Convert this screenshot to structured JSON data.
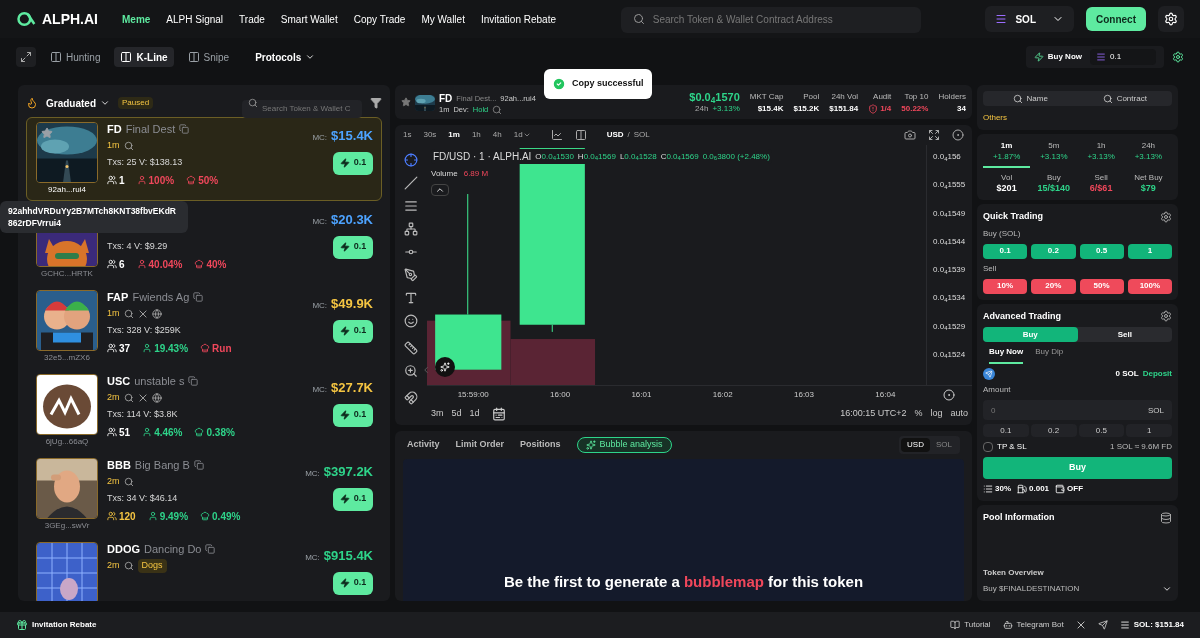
{
  "nav": {
    "logo": "ALPH.AI",
    "items": [
      {
        "label": "Meme",
        "selected": true
      },
      {
        "label": "ALPH Signal",
        "selected": false
      },
      {
        "label": "Trade",
        "selected": false
      },
      {
        "label": "Smart Wallet",
        "selected": false
      },
      {
        "label": "Copy Trade",
        "selected": false
      },
      {
        "label": "My Wallet",
        "selected": false
      },
      {
        "label": "Invitation Rebate",
        "selected": false
      }
    ],
    "search": {
      "placeholder": "Search Token & Wallet Contract Address"
    },
    "chain": "SOL",
    "connect": "Connect"
  },
  "toolbar": {
    "tabs": [
      {
        "label": "Hunting",
        "selected": false
      },
      {
        "label": "K-Line",
        "selected": true
      },
      {
        "label": "Snipe",
        "selected": false
      }
    ],
    "protocols": "Protocols",
    "buy_now": "Buy Now",
    "amount": "0.1"
  },
  "toast": "Copy successful",
  "list": {
    "filter": "Graduated",
    "status": "Paused",
    "search": {
      "placeholder": "Search Token & Wallet C"
    },
    "tooltip": "92ahhdVRDuYy2B7MTch8KNT38fbvEKdR862rDFVrrui4",
    "tokens": [
      {
        "symbol": "FD",
        "name": "Final Dest",
        "age": "1m",
        "socials": false,
        "stats_line": "Txs: 25 V: $138.13",
        "holders": {
          "value": "1",
          "color": "#ffffff"
        },
        "top10": {
          "value": "100%",
          "color": "#f0475b"
        },
        "dev": {
          "value": "50%",
          "color": "#f0475b"
        },
        "address": "92ah...rui4",
        "mc": {
          "label": "MC:",
          "value": "$15.4K",
          "color": "#4da3ff"
        },
        "buy": "0.1",
        "selected": true
      },
      {
        "stats_line": "Txs: 4 V: $9.29",
        "holders": {
          "value": "6",
          "color": "#ffffff"
        },
        "top10": {
          "value": "40.04%",
          "color": "#f0475b"
        },
        "dev": {
          "value": "40%",
          "color": "#f0475b"
        },
        "address": "GCHC...HRTK",
        "mc": {
          "label": "MC:",
          "value": "$20.3K",
          "color": "#4da3ff"
        },
        "buy": "0.1",
        "selected": false
      },
      {
        "symbol": "FAP",
        "name": "Fwiends Ag",
        "age": "1m",
        "socials": true,
        "stats_line": "Txs: 328 V: $259K",
        "holders": {
          "value": "37",
          "color": "#ffffff"
        },
        "top10": {
          "value": "19.43%",
          "color": "#2ed48a"
        },
        "dev": {
          "value": "Run",
          "color": "#f0475b"
        },
        "address": "32e5...mZX6",
        "mc": {
          "label": "MC:",
          "value": "$49.9K",
          "color": "#f5c542"
        },
        "buy": "0.1",
        "selected": false
      },
      {
        "symbol": "USC",
        "name": "unstable s",
        "age": "2m",
        "socials": true,
        "stats_line": "Txs: 114 V: $3.8K",
        "holders": {
          "value": "51",
          "color": "#ffffff"
        },
        "top10": {
          "value": "4.46%",
          "color": "#2ed48a"
        },
        "dev": {
          "value": "0.38%",
          "color": "#2ed48a"
        },
        "address": "6jUg...66aQ",
        "mc": {
          "label": "MC:",
          "value": "$27.7K",
          "color": "#f5c542"
        },
        "buy": "0.1",
        "selected": false
      },
      {
        "symbol": "BBB",
        "name": "Big Bang B",
        "age": "2m",
        "socials": false,
        "stats_line": "Txs: 34 V: $46.14",
        "holders": {
          "value": "120",
          "color": "#f5c542"
        },
        "top10": {
          "value": "9.49%",
          "color": "#2ed48a"
        },
        "dev": {
          "value": "0.49%",
          "color": "#2ed48a"
        },
        "address": "3GEg...swVr",
        "mc": {
          "label": "MC:",
          "value": "$397.2K",
          "color": "#2ed48a"
        },
        "buy": "0.1",
        "selected": false
      },
      {
        "symbol": "DDOG",
        "name": "Dancing Do",
        "age": "2m",
        "socials": false,
        "tag": "Dogs",
        "mc": {
          "label": "MC:",
          "value": "$915.4K",
          "color": "#2ed48a"
        },
        "buy": "0.1",
        "selected": false
      }
    ]
  },
  "token": {
    "symbol": "FD",
    "name": "Final Dest...",
    "address": "92ah...rui4",
    "age": "1m",
    "dev_label": "Dev:",
    "dev_status": "Hold",
    "price": "$0.0$_{4}$1570",
    "change_label": "24h",
    "change": "+3.13%",
    "metrics": [
      {
        "label": "MKT Cap",
        "value": "$15.4K",
        "color": "#ffffff"
      },
      {
        "label": "Pool",
        "value": "$15.2K",
        "color": "#ffffff"
      },
      {
        "label": "24h Vol",
        "value": "$151.84",
        "color": "#ffffff"
      },
      {
        "label": "Audit",
        "value": "1/4",
        "color": "#f0475b",
        "kind": "audit"
      },
      {
        "label": "Top 10",
        "value": "50.22%",
        "color": "#f0475b",
        "kind": "plain"
      },
      {
        "label": "Holders",
        "value": "34",
        "color": "#ffffff"
      }
    ]
  },
  "chart": {
    "timeframes": [
      {
        "label": "1s",
        "selected": false
      },
      {
        "label": "30s",
        "selected": false
      },
      {
        "label": "1m",
        "selected": true
      },
      {
        "label": "1h",
        "selected": false
      },
      {
        "label": "4h",
        "selected": false
      },
      {
        "label": "1d",
        "selected": false
      }
    ],
    "currencies": [
      {
        "label": "USD",
        "selected": true
      },
      {
        "label": "SOL",
        "selected": false
      }
    ],
    "separator": "/",
    "legend": "FD/USD · 1 · ALPH.AI",
    "ohlc": [
      {
        "key": "O",
        "value": "0.0$_{4}$1530"
      },
      {
        "key": "H",
        "value": "0.0$_{4}$1569"
      },
      {
        "key": "L",
        "value": "0.0$_{4}$1528"
      },
      {
        "key": "C",
        "value": "0.0$_{4}$1569"
      }
    ],
    "change": "0.0$_{6}$3800 (+2.48%)",
    "volume_label": "Volume",
    "volume": "6.89 M",
    "y_labels": [
      "0.0$_{4}$156",
      "0.0$_{4}$1555",
      "0.0$_{4}$1549",
      "0.0$_{4}$1544",
      "0.0$_{4}$1539",
      "0.0$_{4}$1534",
      "0.0$_{4}$1529",
      "0.0$_{4}$1524"
    ],
    "x_labels": [
      "15:59:00",
      "16:00",
      "16:01",
      "16:02",
      "16:03",
      "16:04"
    ],
    "ranges": [
      "3m",
      "5d",
      "1d"
    ],
    "time": "16:00:15 UTC+2",
    "scales": [
      "%",
      "log",
      "auto"
    ]
  },
  "bottom": {
    "tabs": [
      {
        "label": "Activity",
        "selected": false
      },
      {
        "label": "Limit Order",
        "selected": false
      },
      {
        "label": "Positions",
        "selected": false
      },
      {
        "label": "Bubble analysis",
        "selected": true
      }
    ],
    "currencies": [
      {
        "label": "USD",
        "selected": true
      },
      {
        "label": "SOL",
        "selected": false
      }
    ],
    "message": {
      "before": "Be the first to generate a ",
      "highlight": "bubblemap",
      "after": " for this token"
    }
  },
  "side": {
    "search_tabs": [
      "Name",
      "Contract"
    ],
    "others": "Others",
    "periods": [
      {
        "label": "1m",
        "change": "+1.87%",
        "selected": true
      },
      {
        "label": "5m",
        "change": "+3.13%",
        "selected": false
      },
      {
        "label": "1h",
        "change": "+3.13%",
        "selected": false
      },
      {
        "label": "24h",
        "change": "+3.13%",
        "selected": false
      }
    ],
    "stats": [
      {
        "label": "Vol",
        "value": "$201",
        "color": "#ffffff"
      },
      {
        "label": "Buy",
        "value": "15/$140",
        "color": "#2ed48a"
      },
      {
        "label": "Sell",
        "value": "6/$61",
        "color": "#f0475b"
      },
      {
        "label": "Net Buy",
        "value": "$79",
        "color": "#2ed48a"
      }
    ],
    "quick": {
      "title": "Quick Trading",
      "buy_label": "Buy (SOL)",
      "buy": [
        "0.1",
        "0.2",
        "0.5",
        "1"
      ],
      "sell_label": "Sell",
      "sell": [
        "10%",
        "20%",
        "50%",
        "100%"
      ]
    },
    "advanced": {
      "title": "Advanced Trading",
      "sides": [
        {
          "label": "Buy",
          "selected": true
        },
        {
          "label": "Sell",
          "selected": false
        }
      ],
      "modes": [
        {
          "label": "Buy Now",
          "selected": true
        },
        {
          "label": "Buy Dip",
          "selected": false
        }
      ],
      "balance": "0 SOL",
      "deposit": "Deposit",
      "amount_label": "Amount",
      "amount_placeholder": "0",
      "unit": "SOL",
      "presets": [
        "0.1",
        "0.2",
        "0.5",
        "1"
      ],
      "tpsl": {
        "label": "TP & SL",
        "checked": false
      },
      "rate": "1 SOL ≈ 9.6M FD",
      "submit": "Buy",
      "slippage": "30%",
      "priority": "0.001",
      "mev": "OFF"
    },
    "pool": {
      "title": "Pool Information",
      "overview": "Token Overview",
      "overview_text": "Buy $FINALDESTINATION"
    }
  },
  "footer": {
    "rebate": "Invitation Rebate",
    "links": [
      {
        "label": "Tutorial",
        "kind": "book"
      },
      {
        "label": "Telegram Bot",
        "kind": "bot"
      }
    ],
    "sol_price": "SOL: $151.84"
  }
}
